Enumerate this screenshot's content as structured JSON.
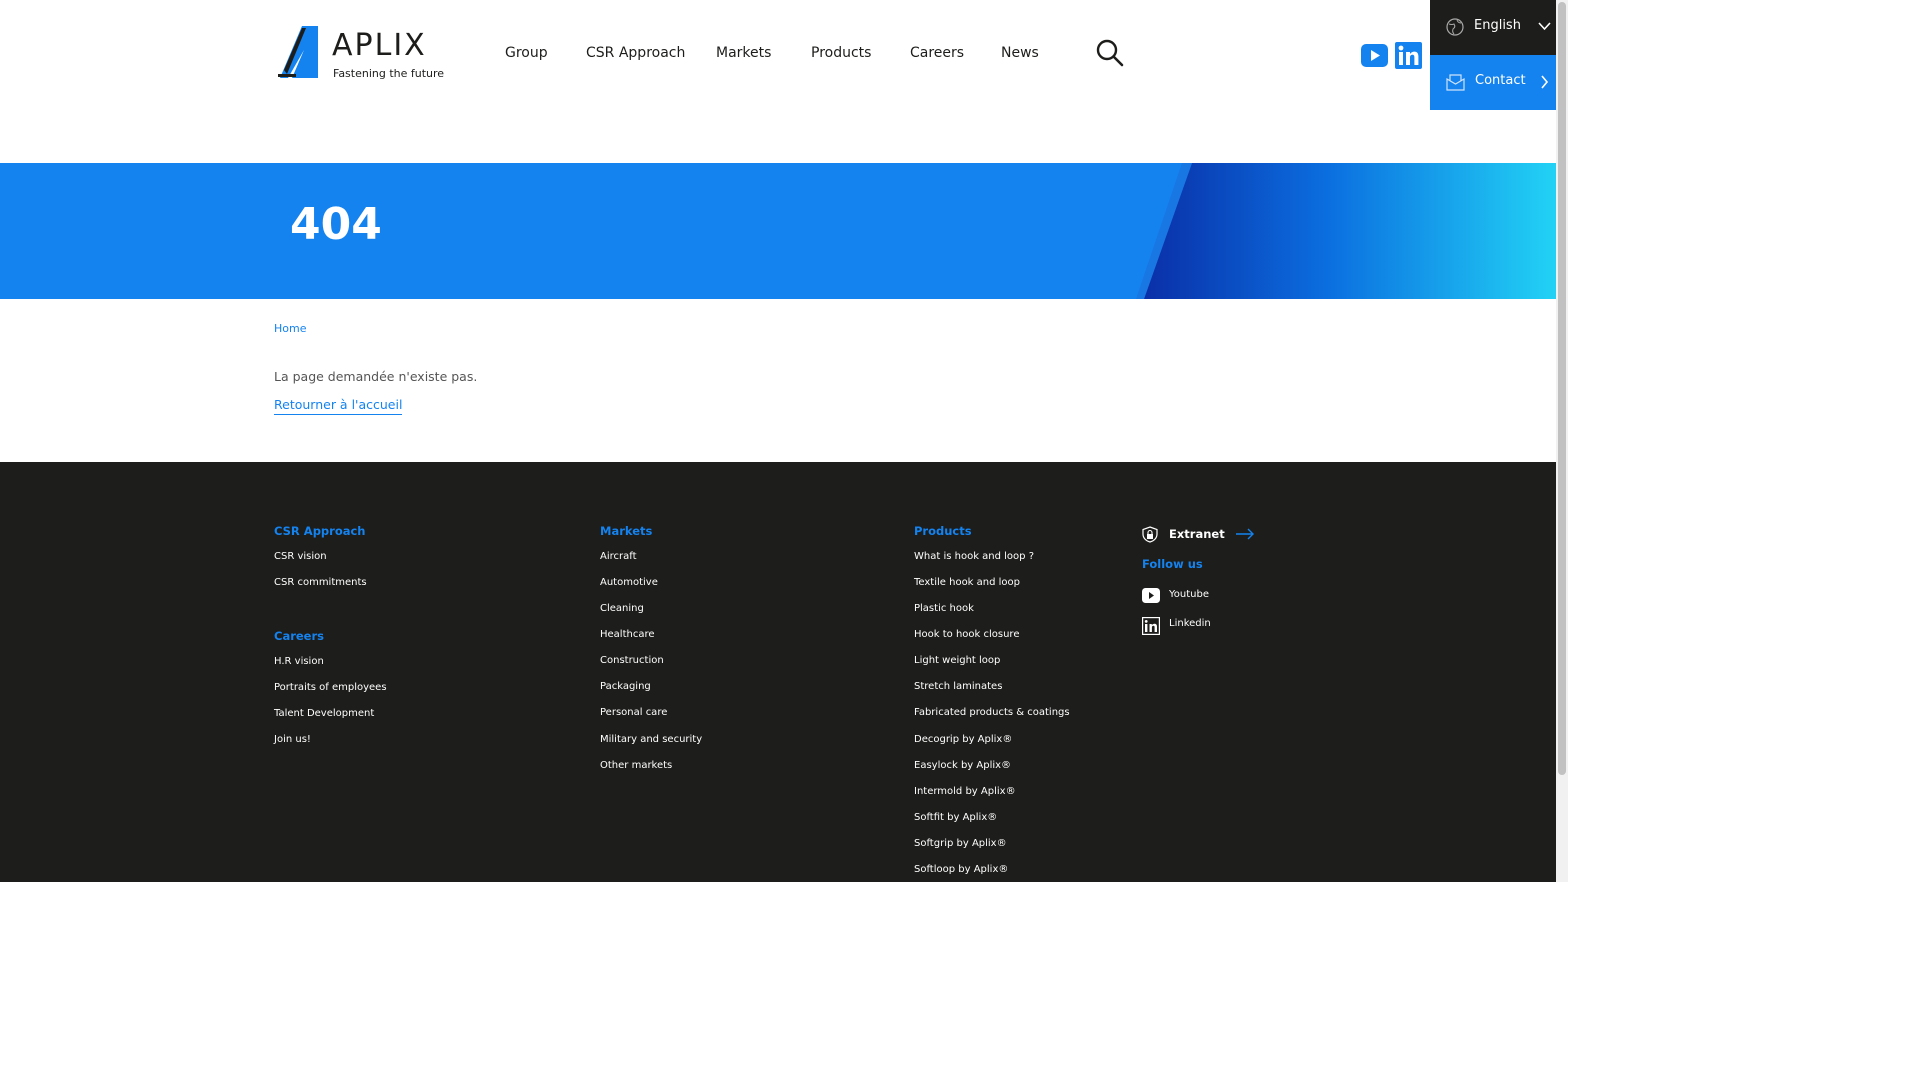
{
  "header": {
    "logo": {
      "word": "APLIX",
      "tagline": "Fastening the future"
    },
    "nav": [
      "Group",
      "CSR Approach",
      "Markets",
      "Products",
      "Careers",
      "News"
    ],
    "language": "English",
    "contact": "Contact",
    "icons": {
      "search": "search-icon",
      "youtube": "youtube-icon",
      "linkedin": "linkedin-icon",
      "globe": "globe-icon",
      "mail": "mail-icon"
    }
  },
  "banner": {
    "title": "404"
  },
  "breadcrumb": {
    "home": "Home"
  },
  "content": {
    "message": "La page demandée n'existe pas.",
    "back_link": "Retourner à l'accueil"
  },
  "footer": {
    "csr": {
      "title": "CSR Approach",
      "links": [
        "CSR vision",
        "CSR commitments"
      ]
    },
    "careers": {
      "title": "Careers",
      "links": [
        "H.R vision",
        "Portraits of employees",
        "Talent Development",
        "Join us!"
      ]
    },
    "markets": {
      "title": "Markets",
      "links": [
        "Aircraft",
        "Automotive",
        "Cleaning",
        "Healthcare",
        "Construction",
        "Packaging",
        "Personal care",
        "Military and security",
        "Other markets"
      ]
    },
    "products": {
      "title": "Products",
      "links": [
        "What is hook and loop ?",
        "Textile hook and loop",
        "Plastic hook",
        "Hook to hook closure",
        "Light weight loop",
        "Stretch laminates",
        "Fabricated products & coatings",
        "Decogrip by Aplix®",
        "Easylock by Aplix®",
        "Intermold by Aplix®",
        "Softfit by Aplix®",
        "Softgrip by Aplix®",
        "Softloop by Aplix®"
      ]
    },
    "extranet": "Extranet",
    "follow": "Follow us",
    "social": [
      "Youtube",
      "Linkedin"
    ]
  },
  "colors": {
    "accent": "#1483f0",
    "dark": "#1d1d1b"
  }
}
